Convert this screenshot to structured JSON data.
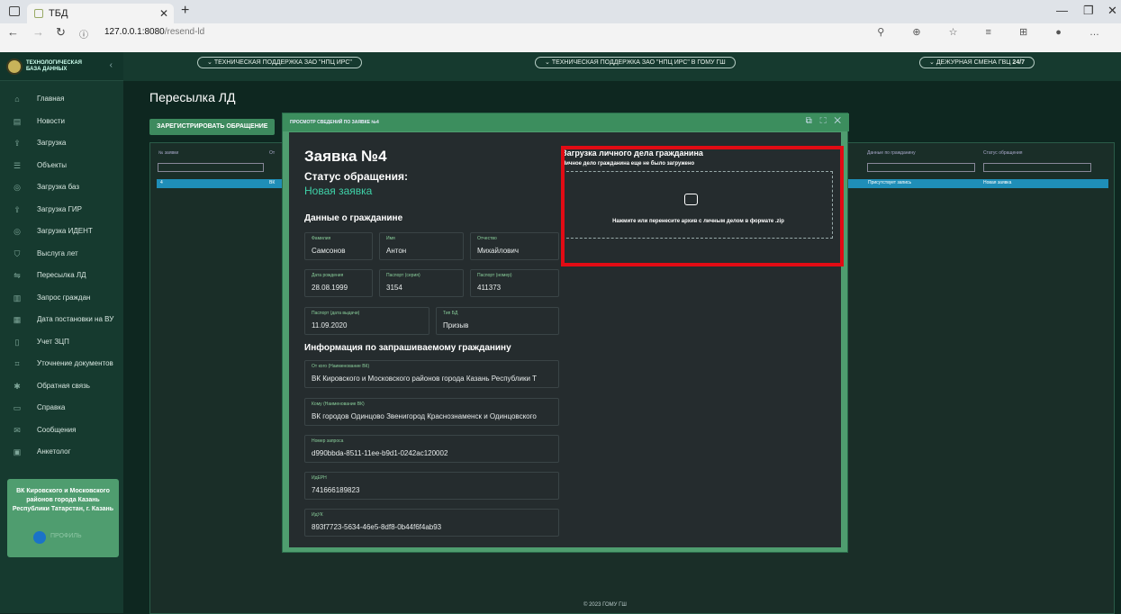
{
  "browser": {
    "tab_title": "ТБД",
    "url_host": "127.0.0.1:8080",
    "url_path": "/resend-ld"
  },
  "sidebar": {
    "logo": "ТЕХНОЛОГИЧЕСКАЯ БАЗА ДАННЫХ",
    "items": [
      {
        "label": "Главная",
        "icon": "home-icon"
      },
      {
        "label": "Новости",
        "icon": "news-icon"
      },
      {
        "label": "Загрузка",
        "icon": "upload-icon"
      },
      {
        "label": "Объекты",
        "icon": "list-icon"
      },
      {
        "label": "Загрузка баз",
        "icon": "database-icon"
      },
      {
        "label": "Загрузка ГИР",
        "icon": "upload-icon"
      },
      {
        "label": "Загрузка ИДЕНТ",
        "icon": "database-icon"
      },
      {
        "label": "Выслуга лет",
        "icon": "shield-icon"
      },
      {
        "label": "Пересылка ЛД",
        "icon": "forward-icon"
      },
      {
        "label": "Запрос граждан",
        "icon": "building-icon"
      },
      {
        "label": "Дата постановки на ВУ",
        "icon": "calendar-icon"
      },
      {
        "label": "Учет ЗЦП",
        "icon": "file-icon"
      },
      {
        "label": "Уточнение документов",
        "icon": "grid-icon"
      },
      {
        "label": "Обратная связь",
        "icon": "chat-icon"
      },
      {
        "label": "Справка",
        "icon": "folder-icon"
      },
      {
        "label": "Сообщения",
        "icon": "mail-icon"
      },
      {
        "label": "Анкетолог",
        "icon": "form-icon"
      }
    ],
    "user": {
      "name": "ВК Кировского и Московского районов города Казань Республики Татарстан, г. Казань",
      "profile": "ПРОФИЛЬ"
    }
  },
  "topbar": {
    "pill1": "ТЕХНИЧЕСКАЯ ПОДДЕРЖКА ЗАО \"НПЦ ИРС\"",
    "pill2": "ТЕХНИЧЕСКАЯ ПОДДЕРЖКА ЗАО \"НПЦ ИРС\" В ГОМУ ГШ",
    "pill3": "ДЕЖУРНАЯ СМЕНА ГВЦ",
    "pill3_bold": "24/7"
  },
  "page": {
    "title": "Пересылка ЛД",
    "register_button": "ЗАРЕГИСТРИРОВАТЬ ОБРАЩЕНИЕ"
  },
  "table": {
    "col_num": "№ заявки",
    "col_from": "От",
    "col_citizen": "Данные по гражданину",
    "col_status": "Статус обращения",
    "row": {
      "num": "4",
      "from": "ВК",
      "citizen": "Присутствует запись",
      "status": "Новая заявка"
    }
  },
  "modal": {
    "header": "ПРОСМОТР СВЕДЕНИЙ ПО ЗАЯВКЕ №4",
    "title": "Заявка №4",
    "status_label": "Статус обращения:",
    "status_value": "Новая заявка",
    "citizen_section": "Данные о гражданине",
    "fields": {
      "surname": {
        "label": "Фамилия",
        "value": "Самсонов"
      },
      "name": {
        "label": "Имя",
        "value": "Антон"
      },
      "patronymic": {
        "label": "Отчество",
        "value": "Михайлович"
      },
      "birth": {
        "label": "Дата рождения",
        "value": "28.08.1999"
      },
      "passport_series": {
        "label": "Паспорт (серия)",
        "value": "3154"
      },
      "passport_number": {
        "label": "Паспорт (номер)",
        "value": "411373"
      },
      "passport_date": {
        "label": "Паспорт (дата выдачи)",
        "value": "11.09.2020"
      },
      "db_type": {
        "label": "Тип БД",
        "value": "Призыв"
      }
    },
    "request_section": "Информация по запрашиваемому гражданину",
    "request_fields": {
      "from": {
        "label": "От кого (Наименование ВК)",
        "value": "ВК Кировского и Московского районов города Казань Республики Т"
      },
      "to": {
        "label": "Кому (Наименование ВК)",
        "value": "ВК городов Одинцово Звенигород Краснознаменск и Одинцовского"
      },
      "request_no": {
        "label": "Номер запроса",
        "value": "d990bbda-8511-11ee-b9d1-0242ac120002"
      },
      "iderp": {
        "label": "ИдЕРН",
        "value": "741666189823"
      },
      "iduk": {
        "label": "ИдУК",
        "value": "893f7723-5634-46e5-8df8-0b44f6f4ab93"
      }
    },
    "upload": {
      "title": "Загрузка личного дела гражданина",
      "subtitle": "Личное дело гражданина еще не было загружено",
      "drop_text": "Нажмите или перенесите архив с личным делом в формате .zip"
    }
  },
  "footer": "© 2023 ГОМУ ГШ"
}
